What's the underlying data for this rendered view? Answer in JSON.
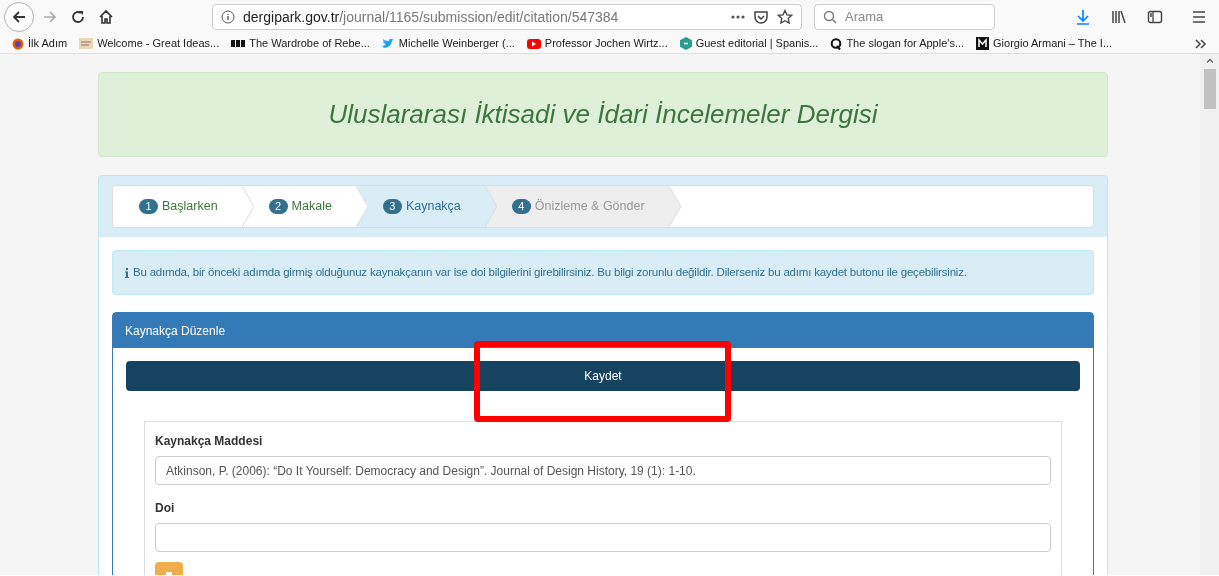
{
  "browser": {
    "url_domain": "dergipark.gov.tr",
    "url_path": "/journal/1165/submission/edit/citation/547384",
    "search": {
      "placeholder": "Arama"
    },
    "bookmarks": [
      {
        "kind": "firefox",
        "label": "İlk Adım"
      },
      {
        "kind": "thumb",
        "label": "Welcome - Great Ideas..."
      },
      {
        "kind": "bbc",
        "label": "The Wardrobe of Rebe..."
      },
      {
        "kind": "bird",
        "label": "Michelle Weinberger (..."
      },
      {
        "kind": "play",
        "label": "Professor Jochen Wirtz..."
      },
      {
        "kind": "e",
        "label": "Guest editorial | Spanis..."
      },
      {
        "kind": "q",
        "label": "The slogan for Apple's..."
      },
      {
        "kind": "m",
        "label": "Giorgio Armani – The I..."
      }
    ]
  },
  "journal_title": "Uluslararası İktisadi ve İdari İncelemeler Dergisi",
  "steps": [
    {
      "number": "1",
      "label": "Başlarken",
      "completed": true,
      "selected": false
    },
    {
      "number": "2",
      "label": "Makale",
      "completed": true,
      "selected": false
    },
    {
      "number": "3",
      "label": "Kaynakça",
      "completed": false,
      "selected": true
    },
    {
      "number": "4",
      "label": "Önizleme & Gönder",
      "completed": false,
      "selected": false
    }
  ],
  "info": "Bu adımda, bir önceki adımda girmiş olduğunuz kaynakçanın var ise doi bilgilerini girebilirsiniz. Bu bilgi zorunlu değildir. Dilerseniz bu adımı kaydet butonu ile geçebilirsiniz.",
  "panel": {
    "title": "Kaynakça Düzenle",
    "save_button": "Kaydet",
    "highlighted": true,
    "entry": {
      "item_label": "Kaynakça Maddesi",
      "item_value": "Atkinson, P. (2006): “Do It Yourself: Democracy and Design”. Journal of Design History, 19 (1): 1-10.",
      "doi_label": "Doi"
    }
  }
}
